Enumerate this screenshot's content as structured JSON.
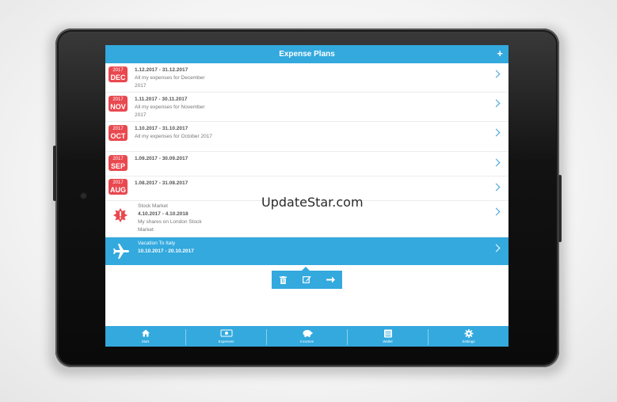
{
  "app": {
    "title": "Expense Plans",
    "add_label": "+"
  },
  "plans": [
    {
      "year": "2017",
      "month": "DEC",
      "dates": "1.12.2017 - 31.12.2017",
      "desc": "All my expenses for December 2017"
    },
    {
      "year": "2017",
      "month": "NOV",
      "dates": "1.11.2017 - 30.11.2017",
      "desc": "All my expenses for November 2017"
    },
    {
      "year": "2017",
      "month": "OCT",
      "dates": "1.10.2017 - 31.10.2017",
      "desc": "All my expenses for October 2017"
    },
    {
      "year": "2017",
      "month": "SEP",
      "dates": "1.09.2017 - 30.09.2017",
      "desc": ""
    },
    {
      "year": "2017",
      "month": "AUG",
      "dates": "1.08.2017 - 31.08.2017",
      "desc": ""
    }
  ],
  "stock_plan": {
    "name": "Stock Market",
    "dates": "4.10.2017 - 4.10.2018",
    "desc": "My shares on London Stock Market",
    "icon": "alert-burst-icon"
  },
  "vacation_plan": {
    "name": "Vacation To Italy",
    "dates": "10.10.2017 - 20.10.2017",
    "icon": "airplane-icon"
  },
  "actions": [
    {
      "icon": "trash-icon"
    },
    {
      "icon": "edit-icon"
    },
    {
      "icon": "arrow-right-icon"
    }
  ],
  "tabs": [
    {
      "label": "Start",
      "icon": "home-icon"
    },
    {
      "label": "Expenses",
      "icon": "money-icon"
    },
    {
      "label": "Incomes",
      "icon": "piggy-bank-icon"
    },
    {
      "label": "Wallet",
      "icon": "wallet-icon"
    },
    {
      "label": "Settings",
      "icon": "gear-icon"
    }
  ],
  "watermark": "UpdateStar.com",
  "colors": {
    "accent": "#33a9de",
    "badge": "#e9484f",
    "alert": "#e9484f"
  }
}
